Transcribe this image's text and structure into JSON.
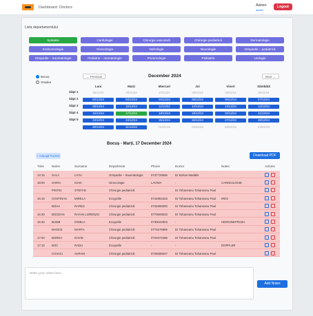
{
  "header": {
    "nav": [
      "Dashboard",
      "Doctors"
    ],
    "user_name": "Admin",
    "user_role": "admin",
    "logout_label": "Logout"
  },
  "departments": {
    "title": "Lista departamentului",
    "items": [
      "Spitalele",
      "Cardiologie",
      "Chirurgie vasculară",
      "Chirurgie pediatrică",
      "Dermatologie",
      "Endocrinologie",
      "Ginecologie",
      "Nefrologie",
      "Neurologie",
      "Ortopedie – pediatrică",
      "Ortopedie – traumatologie",
      "Pediatrie – neonatologie",
      "Pneumologie",
      "Psihiatrie",
      "Urologie"
    ],
    "active_index": 0
  },
  "view_options": {
    "items": [
      "Bocuș",
      "Oradea"
    ],
    "selected": 0
  },
  "calendar": {
    "prev_label": "← Previous",
    "next_label": "Next →",
    "month_title": "December 2024",
    "days": [
      "Luni",
      "Marți",
      "Miercuri",
      "Joi",
      "Vineri",
      "Sâmbătă"
    ],
    "weeks": [
      {
        "label": "Săpt 1",
        "dates": [
          "25/11/24",
          "26/11/24",
          "27/11/24",
          "28/11/24",
          "29/11/24",
          "30/11/24"
        ],
        "off": [
          0,
          1,
          2,
          3,
          4,
          5
        ]
      },
      {
        "label": "Săpt 2",
        "dates": [
          "02/12/24",
          "03/12/24",
          "04/12/24",
          "05/12/24",
          "06/12/24",
          "07/12/24"
        ],
        "off": []
      },
      {
        "label": "Săpt 3",
        "dates": [
          "09/12/24",
          "10/12/24",
          "11/12/24",
          "12/12/24",
          "13/12/24",
          "14/12/24"
        ],
        "off": []
      },
      {
        "label": "Săpt 4",
        "dates": [
          "16/12/24",
          "17/12/24",
          "18/12/24",
          "19/12/24",
          "20/12/24",
          "21/12/24"
        ],
        "off": []
      },
      {
        "label": "Săpt 5",
        "dates": [
          "23/12/24",
          "24/12/24",
          "25/12/24",
          "26/12/24",
          "27/12/24",
          "28/12/24"
        ],
        "off": []
      },
      {
        "label": "",
        "dates": [
          "30/12/24",
          "31/12/24",
          "01/01/25",
          "02/01/25",
          "03/01/25",
          "04/01/25"
        ],
        "off": [
          2,
          3,
          4,
          5
        ]
      }
    ],
    "selected": {
      "week": 3,
      "day": 1
    }
  },
  "schedule": {
    "title": "Bocuș - Marți, 17 December 2024",
    "add_label": "+ Adaugă Pacient",
    "pdf_label": "Download PDF",
    "columns": [
      "Time",
      "Name",
      "Surname",
      "Department",
      "Phone",
      "Doctor",
      "Notes",
      "Actions"
    ],
    "rows": [
      [
        "14:15",
        "SALA",
        "LIVIU",
        "Ortopedie – traumatologie",
        "0737729656",
        "Dr Bohan Madalin",
        ""
      ],
      [
        "18:00",
        "CHIRA",
        "IOAN",
        "Ginecologie",
        "LAVIMA",
        "-",
        "CARDIOLOGIE"
      ],
      [
        "",
        "PINTIN",
        "STEFAN",
        "Chirurgie pediatrică",
        "-",
        "Dr Tohaneanu Tohaneanu Paul",
        ""
      ],
      [
        "16:15",
        "COSTINAS",
        "MIRELA",
        "Ecografie",
        "0744864423",
        "Dr Tohaneanu Tohaneanu Paul",
        "IRES"
      ],
      [
        "",
        "BOHA",
        "RARES",
        "Chirurgie pediatrică",
        "0734880000",
        "Dr Tohaneanu Tohaneanu Paul",
        ""
      ],
      [
        "16:30",
        "BOGDAN",
        "RAYAN LORENZO",
        "Chirurgie pediatrică",
        "0770609033",
        "Dr Tohaneanu Tohaneanu Paul",
        ""
      ],
      [
        "16:45",
        "BUMB",
        "IONELA",
        "Ecografie",
        "0730022903",
        "-",
        "HIDRONEFROZA"
      ],
      [
        "",
        "MANCE",
        "MARTA",
        "Chirurgie pediatrică",
        "0774675989",
        "Dr Tohaneanu Tohaneanu Paul",
        ""
      ],
      [
        "17:00",
        "BORDA",
        "DAVID",
        "Chirurgie pediatrică",
        "0723374486",
        "Dr Tohaneanu Tohaneanu Paul",
        ""
      ],
      [
        "17:15",
        "BOC",
        "RADU",
        "Ecografie",
        "-",
        "-",
        "DOPPLER"
      ],
      [
        "",
        "COVACI",
        "AVRAM",
        "Chirurgie pediatrică",
        "0726555047",
        "Dr Tohaneanu Tohaneanu Paul",
        ""
      ]
    ]
  },
  "notes": {
    "placeholder": "Write your notes here...",
    "add_label": "Add Notes"
  }
}
